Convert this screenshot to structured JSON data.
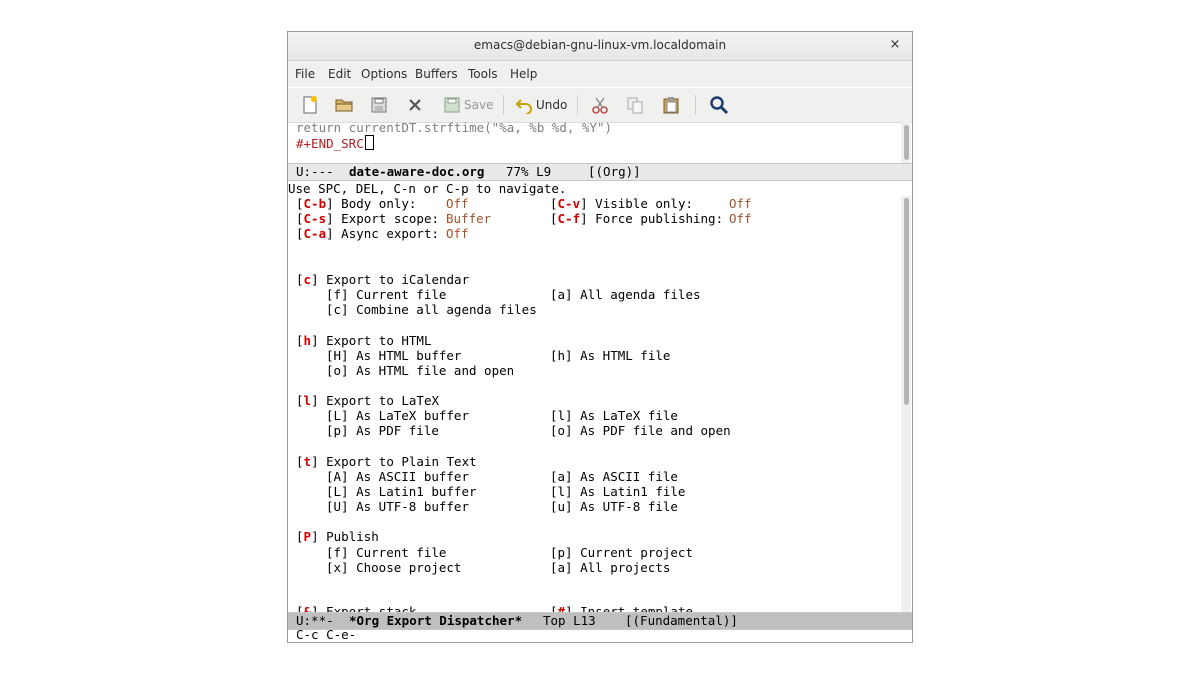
{
  "window": {
    "title": "emacs@debian-gnu-linux-vm.localdomain",
    "close_glyph": "×"
  },
  "menu": [
    "File",
    "Edit",
    "Options",
    "Buffers",
    "Tools",
    "Help"
  ],
  "toolbar": {
    "new_file_icon": "new-file-icon",
    "open_icon": "folder-icon",
    "save_buffer_icon": "save-icon",
    "close_icon": "close-x-icon",
    "save_label": "Save",
    "undo_label": "Undo",
    "cut_icon": "scissors-icon",
    "copy_icon": "copy-icon",
    "paste_icon": "paste-icon",
    "search_icon": "search-icon"
  },
  "upper_buffer": {
    "line1": "return currentDT.strftime(\"%a, %b %d, %Y\")",
    "line2": "#+END_SRC",
    "modeline": {
      "status": "U:---",
      "buffer": "date-aware-doc.org",
      "position": "77% L9",
      "mode": "[(Org)]"
    }
  },
  "echo_area": "Use SPC, DEL, C-n or C-p to navigate.",
  "dispatcher": {
    "options": [
      {
        "key": "C-b",
        "label": "Body only:",
        "value": "Off"
      },
      {
        "key": "C-v",
        "label": "Visible only:",
        "value": "Off"
      },
      {
        "key": "C-s",
        "label": "Export scope:",
        "value": "Buffer"
      },
      {
        "key": "C-f",
        "label": "Force publishing:",
        "value": "Off"
      },
      {
        "key": "C-a",
        "label": "Async export:",
        "value": "Off"
      }
    ],
    "sections": [
      {
        "key": "c",
        "title": "Export to iCalendar",
        "rows": [
          [
            "[f] Current file",
            "[a] All agenda files"
          ],
          [
            "[c] Combine all agenda files",
            ""
          ]
        ]
      },
      {
        "key": "h",
        "title": "Export to HTML",
        "rows": [
          [
            "[H] As HTML buffer",
            "[h] As HTML file"
          ],
          [
            "[o] As HTML file and open",
            ""
          ]
        ]
      },
      {
        "key": "l",
        "title": "Export to LaTeX",
        "rows": [
          [
            "[L] As LaTeX buffer",
            "[l] As LaTeX file"
          ],
          [
            "[p] As PDF file",
            "[o] As PDF file and open"
          ]
        ]
      },
      {
        "key": "t",
        "title": "Export to Plain Text",
        "rows": [
          [
            "[A] As ASCII buffer",
            "[a] As ASCII file"
          ],
          [
            "[L] As Latin1 buffer",
            "[l] As Latin1 file"
          ],
          [
            "[U] As UTF-8 buffer",
            "[u] As UTF-8 file"
          ]
        ]
      },
      {
        "key": "P",
        "title": "Publish",
        "rows": [
          [
            "[f] Current file",
            "[p] Current project"
          ],
          [
            "[x] Choose project",
            "[a] All projects"
          ]
        ]
      }
    ],
    "footer": {
      "left_key": "&",
      "left_label": "Export stack",
      "right_key": "#",
      "right_label": "Insert template"
    }
  },
  "lower_modeline": {
    "status": "U:**-",
    "buffer": "*Org Export Dispatcher*",
    "position": "Top L13",
    "mode": "[(Fundamental)]"
  },
  "minibuffer": "C-c C-e-"
}
